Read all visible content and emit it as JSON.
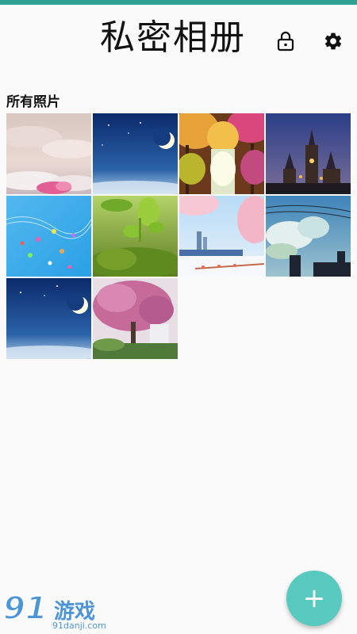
{
  "header": {
    "title": "私密相册",
    "lock_icon": "lock-icon",
    "settings_icon": "gear-icon"
  },
  "section": {
    "title": "所有照片"
  },
  "photos": [
    {
      "name": "photo-clouds-pink"
    },
    {
      "name": "photo-night-moon"
    },
    {
      "name": "photo-autumn-forest"
    },
    {
      "name": "photo-castle-night"
    },
    {
      "name": "photo-music-notes"
    },
    {
      "name": "photo-green-sprout"
    },
    {
      "name": "photo-cherry-city"
    },
    {
      "name": "photo-sky-wires"
    },
    {
      "name": "photo-night-moon-2"
    },
    {
      "name": "photo-blossom-tree"
    }
  ],
  "fab": {
    "label": "+"
  },
  "watermark": {
    "logo": "91",
    "text": "游戏",
    "url": "91danji.com"
  },
  "colors": {
    "accent": "#2fa193",
    "fab": "#58c9bf"
  }
}
